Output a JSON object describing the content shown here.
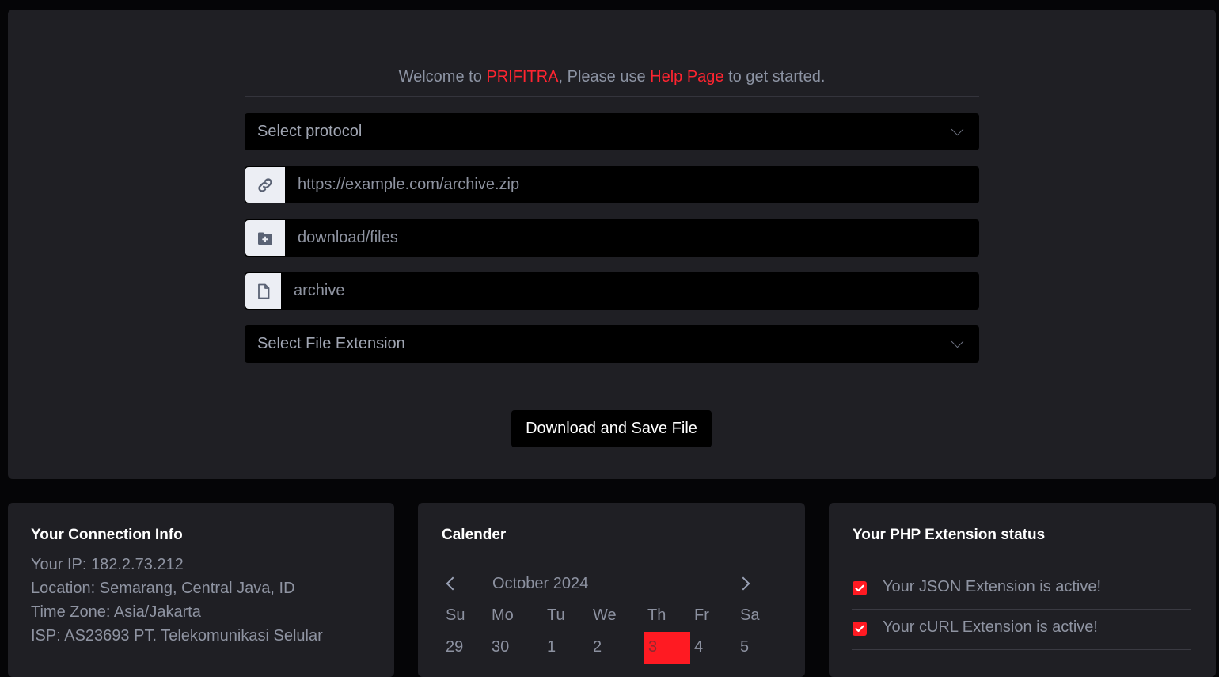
{
  "welcome": {
    "prefix": "Welcome to ",
    "brand": "PRIFITRA",
    "middle": ", Please use ",
    "help_link": "Help Page",
    "suffix": " to get started."
  },
  "form": {
    "protocol_select": "Select protocol",
    "url_placeholder": "https://example.com/archive.zip",
    "folder_placeholder": "download/files",
    "filename_value": "archive",
    "extension_select": "Select File Extension",
    "submit_label": "Download and Save File"
  },
  "connection": {
    "title": "Your Connection Info",
    "ip": "Your IP: 182.2.73.212",
    "location": "Location: Semarang, Central Java, ID",
    "timezone": "Time Zone: Asia/Jakarta",
    "isp": "ISP: AS23693 PT. Telekomunikasi Selular"
  },
  "calendar": {
    "title": "Calender",
    "month": "October 2024",
    "weekdays": [
      "Su",
      "Mo",
      "Tu",
      "We",
      "Th",
      "Fr",
      "Sa"
    ],
    "days": [
      "29",
      "30",
      "1",
      "2",
      "3",
      "4",
      "5"
    ],
    "today": "3"
  },
  "php": {
    "title": "Your PHP Extension status",
    "items": [
      {
        "label": "Your JSON Extension is active!",
        "checked": true
      },
      {
        "label": "Your cURL Extension is active!",
        "checked": true
      }
    ]
  },
  "colors": {
    "accent": "#ff1a22",
    "page_bg": "#050507",
    "card_bg": "#1f1f24",
    "input_bg": "#000000"
  },
  "icons": {
    "url": "link-icon",
    "folder": "folder-plus-icon",
    "file": "file-icon",
    "dropdown": "chevron-down-icon"
  }
}
